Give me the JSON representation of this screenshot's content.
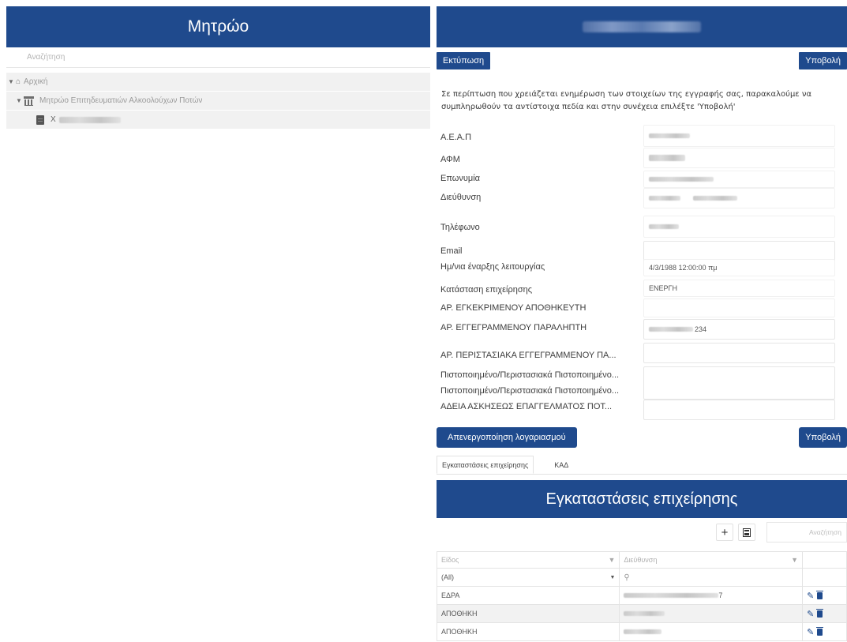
{
  "left": {
    "title": "Μητρώο",
    "search_placeholder": "Αναζήτηση",
    "tree": [
      {
        "label": "Αρχική",
        "icon": "home-icon"
      },
      {
        "label": "Μητρώο Επιτηδευματιών Αλκοολούχων Ποτών",
        "icon": "bank-icon"
      },
      {
        "label": "X",
        "icon": "building-icon"
      }
    ]
  },
  "right": {
    "print_label": "Εκτύπωση",
    "submit_label": "Υποβολή",
    "notice": "Σε περίπτωση που χρειάζεται ενημέρωση των στοιχείων της εγγραφής σας, παρακαλούμε να συμπληρωθούν τα αντίστοιχα πεδία και στην συνέχεια επιλέξτε 'Υποβολή'",
    "fields": [
      {
        "label": "Α.Ε.Α.Π",
        "value": ""
      },
      {
        "label": "ΑΦΜ",
        "value": ""
      },
      {
        "label": "Επωνυμία",
        "value": ""
      },
      {
        "label": "Διεύθυνση",
        "value": ""
      },
      {
        "label": "Τηλέφωνο",
        "value": ""
      },
      {
        "label": "Email",
        "value": ""
      },
      {
        "label": "Ημ/νια έναρξης λειτουργίας",
        "value": "4/3/1988 12:00:00 πμ"
      },
      {
        "label": "Κατάσταση επιχείρησης",
        "value": "ΕΝΕΡΓΗ"
      },
      {
        "label": "ΑΡ. ΕΓΚΕΚΡΙΜΕΝΟΥ ΑΠΟΘΗΚΕΥΤΗ",
        "value": ""
      },
      {
        "label": "ΑΡ. ΕΓΓΕΓΡΑΜΜΕΝΟΥ ΠΑΡΑΛΗΠΤΗ",
        "value": "234"
      },
      {
        "label": "ΑΡ. ΠΕΡΙΣΤΑΣΙΑΚΑ ΕΓΓΕΓΡΑΜΜΕΝΟΥ ΠΑ...",
        "value": ""
      },
      {
        "label": "Πιστοποιημένο/Περιστασιακά Πιστοποιημένο...",
        "value": ""
      },
      {
        "label": "Πιστοποιημένο/Περιστασιακά Πιστοποιημένο...",
        "value": ""
      },
      {
        "label": "ΑΔΕΙΑ ΑΣΚΗΣΕΩΣ ΕΠΑΓΓΕΛΜΑΤΟΣ ΠΟΤ...",
        "value": ""
      }
    ],
    "deactivate_label": "Απενεργοποίηση λογαριασμού",
    "submit_bottom_label": "Υποβολή",
    "tabs": [
      "Εγκαταστάσεις επιχείρησης",
      "ΚΑΔ"
    ],
    "grid": {
      "title": "Εγκαταστάσεις επιχείρησης",
      "add_icon": "plus-icon",
      "export_icon": "export-icon",
      "search_placeholder": "Αναζήτηση",
      "columns": [
        "Είδος",
        "Διεύθυνση"
      ],
      "filter_value": "(All)",
      "rows": [
        {
          "kind": "ΕΔΡΑ",
          "address_suffix": "7"
        },
        {
          "kind": "ΑΠΟΘΗΚΗ",
          "address_suffix": ""
        },
        {
          "kind": "ΑΠΟΘΗΚΗ",
          "address_suffix": ""
        }
      ]
    }
  },
  "colors": {
    "brand": "#1f4a8d",
    "row_alt": "#f2f2f2",
    "tree_row": "#f1f1f1"
  }
}
